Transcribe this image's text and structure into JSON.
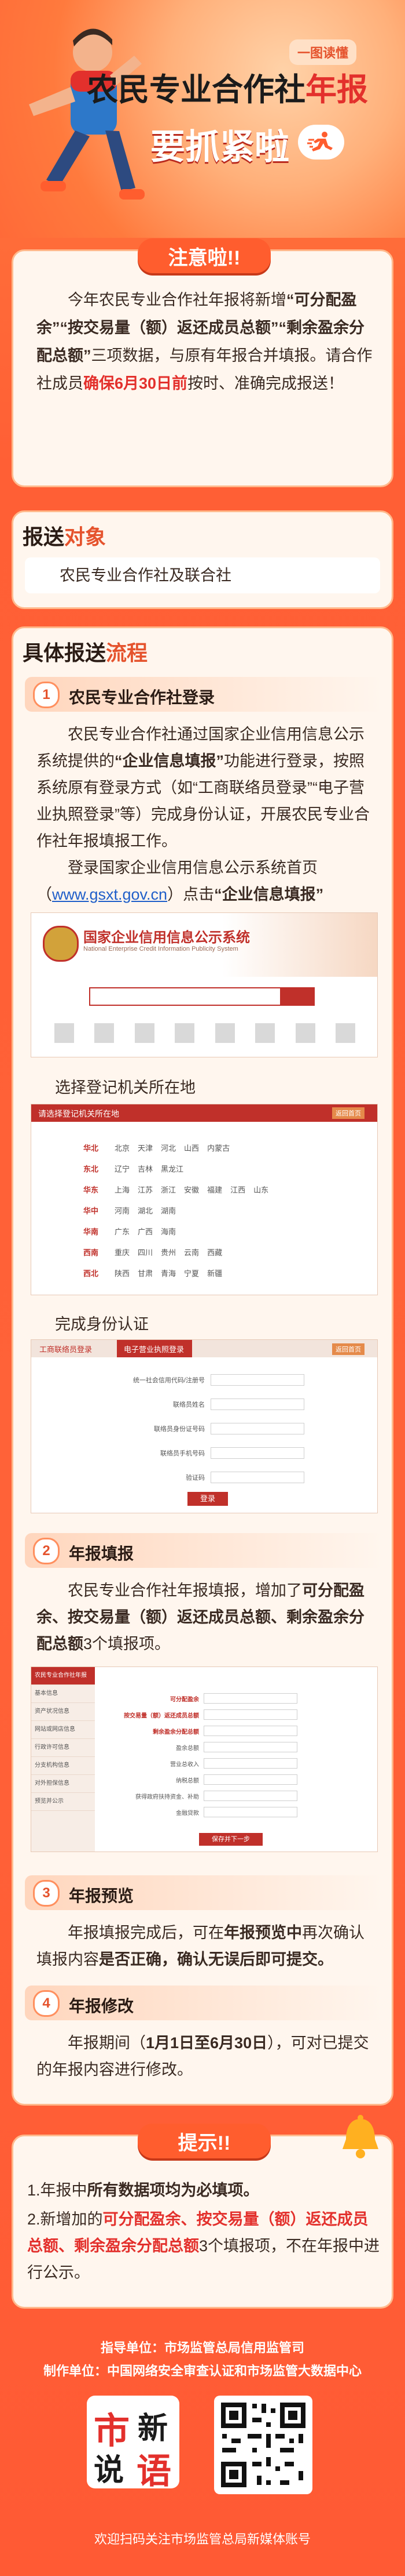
{
  "header": {
    "tag": "一图读懂",
    "title_main": "农民专业合作社",
    "title_accent": "年报",
    "title_line2": "要抓紧啦"
  },
  "notice": {
    "title": "注意啦!!",
    "text_1": "今年农民专业合作社年报将新增",
    "text_2": "“可分配盈余”",
    "text_3": "“按交易量（额）返还成员总额”",
    "text_4": "“剩余盈余分配总额”",
    "text_5": "三项数据，与原有年报合并填报。请合作社成员",
    "text_6": "确保6月30日前",
    "text_7": "按时、准确完成报送！"
  },
  "target": {
    "title_a": "报送",
    "title_b": "对象",
    "text": "农民专业合作社及联合社"
  },
  "process": {
    "title_a": "具体报送",
    "title_b": "流程",
    "step1": {
      "num": "1",
      "title": "农民专业合作社登录",
      "p1a": "农民专业合作社通过国家企业信用信息公示系统提供的",
      "p1b": "“企业信息填报”",
      "p1c": "功能进行登录，按照系统原有登录方式（如“工商联络员登录”“电子营业执照登录”等）完成身份认证，开展农民专业合作社年报填报工作。",
      "p2a": "登录国家企业信用信息公示系统首页（",
      "p2link": "www.gsxt.gov.cn",
      "p2b": "）点击",
      "p2c": "“企业信息填报”",
      "shot1_title": "国家企业信用信息公示系统",
      "shot1_sub": "National Enterprise Credit Information Publicity System",
      "caption2": "选择登记机关所在地",
      "caption3": "完成身份认证",
      "shot2_bar": "请选择登记机关所在地",
      "shot2_btn": "返回首页",
      "shot2_regions": [
        [
          "华北",
          "北京",
          "天津",
          "河北",
          "山西",
          "内蒙古"
        ],
        [
          "东北",
          "辽宁",
          "吉林",
          "黑龙江"
        ],
        [
          "华东",
          "上海",
          "江苏",
          "浙江",
          "安徽",
          "福建",
          "江西",
          "山东"
        ],
        [
          "华中",
          "河南",
          "湖北",
          "湖南"
        ],
        [
          "华南",
          "广东",
          "广西",
          "海南"
        ],
        [
          "西南",
          "重庆",
          "四川",
          "贵州",
          "云南",
          "西藏"
        ],
        [
          "西北",
          "陕西",
          "甘肃",
          "青海",
          "宁夏",
          "新疆"
        ]
      ],
      "shot3_tab1": "工商联络员登录",
      "shot3_tab2": "电子营业执照登录",
      "shot3_btn": "返回首页",
      "shot3_rows": [
        "统一社会信用代码/注册号",
        "联络员姓名",
        "联络员身份证号码",
        "联络员手机号码",
        "验证码"
      ],
      "shot3_login": "登录"
    },
    "step2": {
      "num": "2",
      "title": "年报填报",
      "pa": "农民专业合作社年报填报，增加了",
      "pb": "可分配盈余、按交易量（额）返还成员总额、剩余盈余分配总额",
      "pc": "3个填报项。",
      "shot_menu": [
        "农民专业合作社年报",
        "基本信息",
        "资产状况信息",
        "网站或网店信息",
        "行政许可信息",
        "分支机构信息",
        "对外担保信息",
        "预览并公示"
      ],
      "shot_fields": [
        "可分配盈余",
        "按交易量（额）返还成员总额",
        "剩余盈余分配总额",
        "盈余总额",
        "营业总收入",
        "纳税总额",
        "获得政府扶持资金、补助",
        "金融贷款"
      ],
      "shot_btn": "保存并下一步"
    },
    "step3": {
      "num": "3",
      "title": "年报预览",
      "pa": "年报填报完成后，可在",
      "pb": "年报预览中",
      "pc": "再次确认填报内容",
      "pd": "是否正确，确认无误后即可提交。"
    },
    "step4": {
      "num": "4",
      "title": "年报修改",
      "pa": "年报期间（",
      "pb": "1月1日至6月30日",
      "pc": "），可对已提交的年报内容进行修改。"
    }
  },
  "tips": {
    "title": "提示!!",
    "t1a": "1.年报中",
    "t1b": "所有数据项均为必填项。",
    "t2a": "2.新增加的",
    "t2b": "可分配盈余、按交易量（额）返还成员总额、剩余盈余分配总额",
    "t2c": "3个填报项，不在年报中进行公示。"
  },
  "footer": {
    "guide": "指导单位：市场监管总局信用监管司",
    "maker": "制作单位：中国网络安全审查认证和市场监管大数据中心",
    "logo_a": "市",
    "logo_b": "新",
    "logo_c": "说",
    "logo_d": "语",
    "qr_hint": "欢迎扫码关注市场监管总局新媒体账号"
  },
  "colors": {
    "accent": "#e3302c",
    "orange": "#ff5d2e",
    "cream": "#fff6ee"
  }
}
